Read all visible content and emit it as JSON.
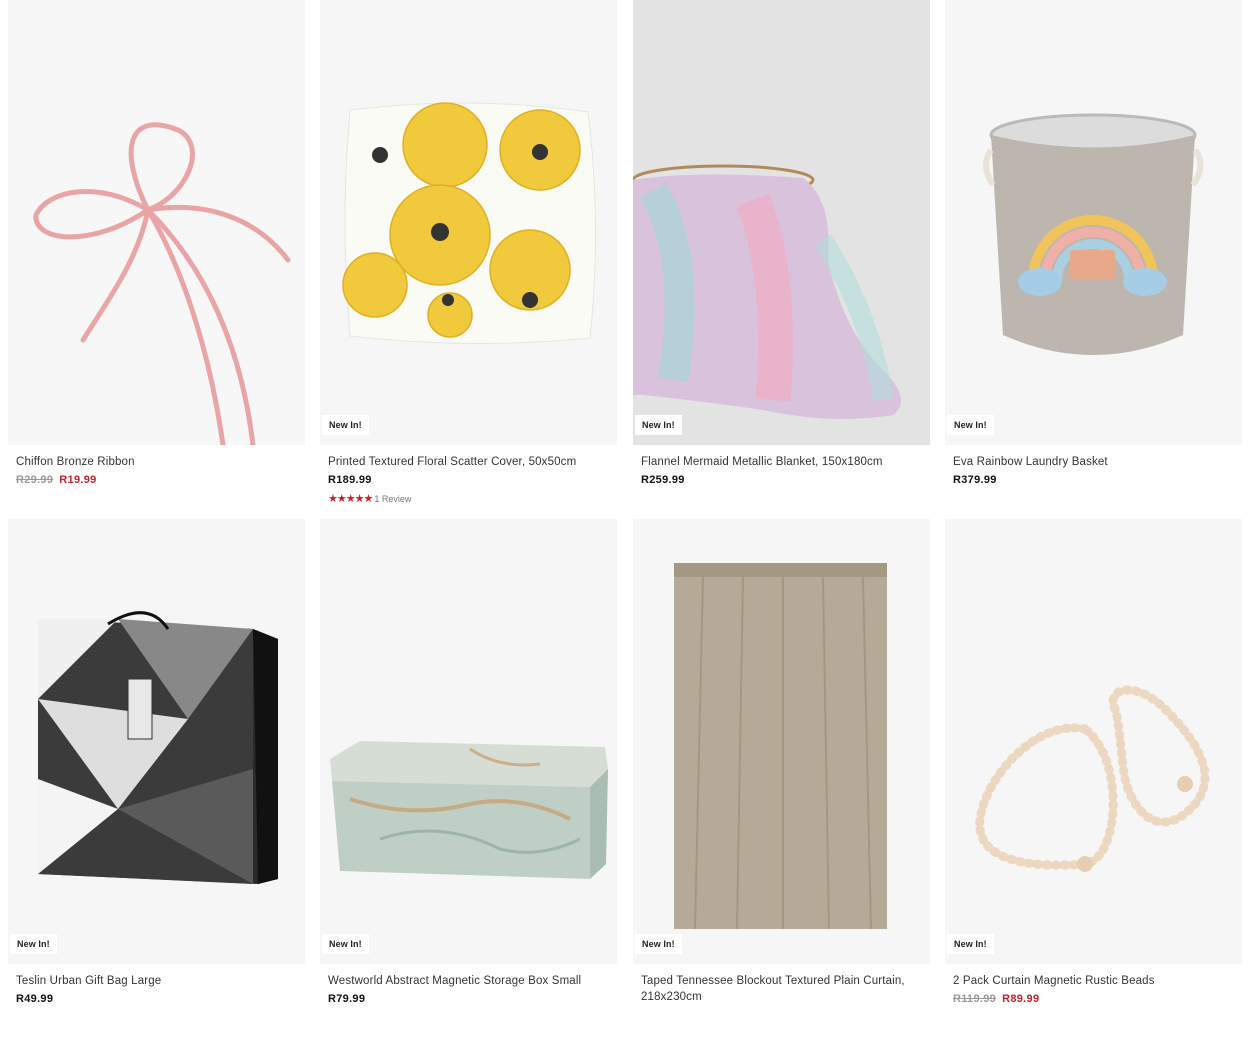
{
  "colors": {
    "sale": "#c8202e",
    "text": "#333333",
    "image_bg": "#f6f6f6"
  },
  "products": [
    {
      "name": "Chiffon Bronze Ribbon",
      "was_price": "R29.99",
      "price": "R19.99",
      "badge": ""
    },
    {
      "name": "Printed Textured Floral Scatter Cover, 50x50cm",
      "was_price": "",
      "price": "R189.99",
      "badge": "New In!",
      "rating_stars": 5,
      "rating_text": "1 Review"
    },
    {
      "name": "Flannel Mermaid Metallic Blanket, 150x180cm",
      "was_price": "",
      "price": "R259.99",
      "badge": "New In!"
    },
    {
      "name": "Eva Rainbow Laundry Basket",
      "was_price": "",
      "price": "R379.99",
      "badge": "New In!"
    },
    {
      "name": "Teslin Urban Gift Bag Large",
      "was_price": "",
      "price": "R49.99",
      "badge": "New In!"
    },
    {
      "name": "Westworld Abstract Magnetic Storage Box Small",
      "was_price": "",
      "price": "R79.99",
      "badge": "New In!"
    },
    {
      "name": "Taped Tennessee Blockout Textured Plain Curtain, 218x230cm",
      "was_price": "",
      "price": "",
      "badge": "New In!"
    },
    {
      "name": "2 Pack Curtain Magnetic Rustic Beads",
      "was_price": "R119.99",
      "price": "R89.99",
      "badge": "New In!"
    }
  ]
}
